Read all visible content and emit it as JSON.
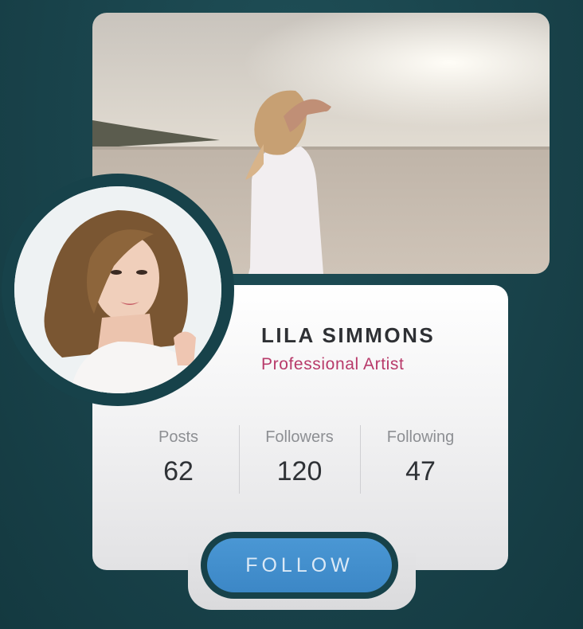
{
  "profile": {
    "name": "LILA SIMMONS",
    "role": "Professional Artist"
  },
  "stats": [
    {
      "label": "Posts",
      "value": "62"
    },
    {
      "label": "Followers",
      "value": "120"
    },
    {
      "label": "Following",
      "value": "47"
    }
  ],
  "actions": {
    "follow_label": "FOLLOW"
  },
  "colors": {
    "background": "#19434b",
    "role_text": "#b83a6a",
    "button": "#3c87c6"
  }
}
